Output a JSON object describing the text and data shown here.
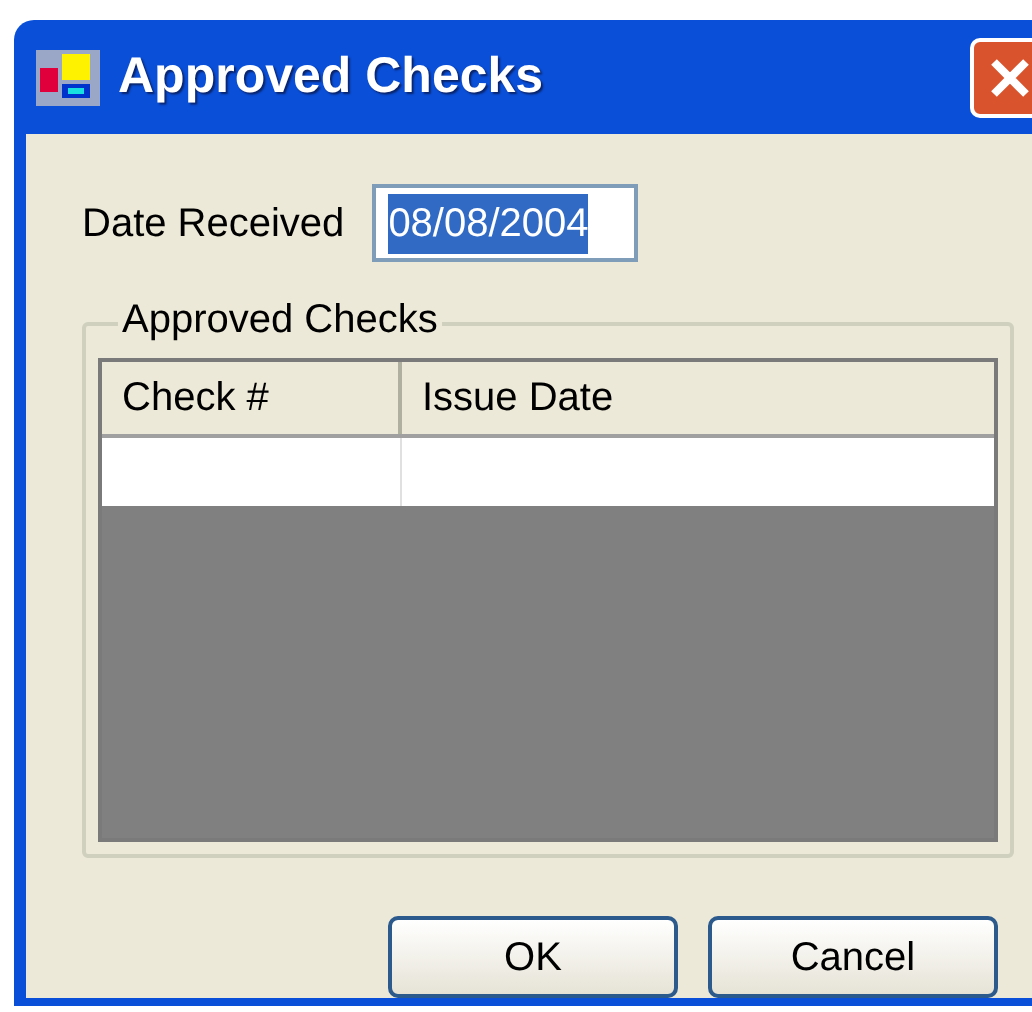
{
  "window": {
    "title": "Approved Checks"
  },
  "date_received": {
    "label": "Date Received",
    "value": "08/08/2004",
    "selected": true
  },
  "group": {
    "title": "Approved Checks"
  },
  "table": {
    "columns": [
      "Check #",
      "Issue Date"
    ]
  },
  "buttons": [
    {
      "label": "OK"
    },
    {
      "label": "Cancel"
    }
  ]
}
